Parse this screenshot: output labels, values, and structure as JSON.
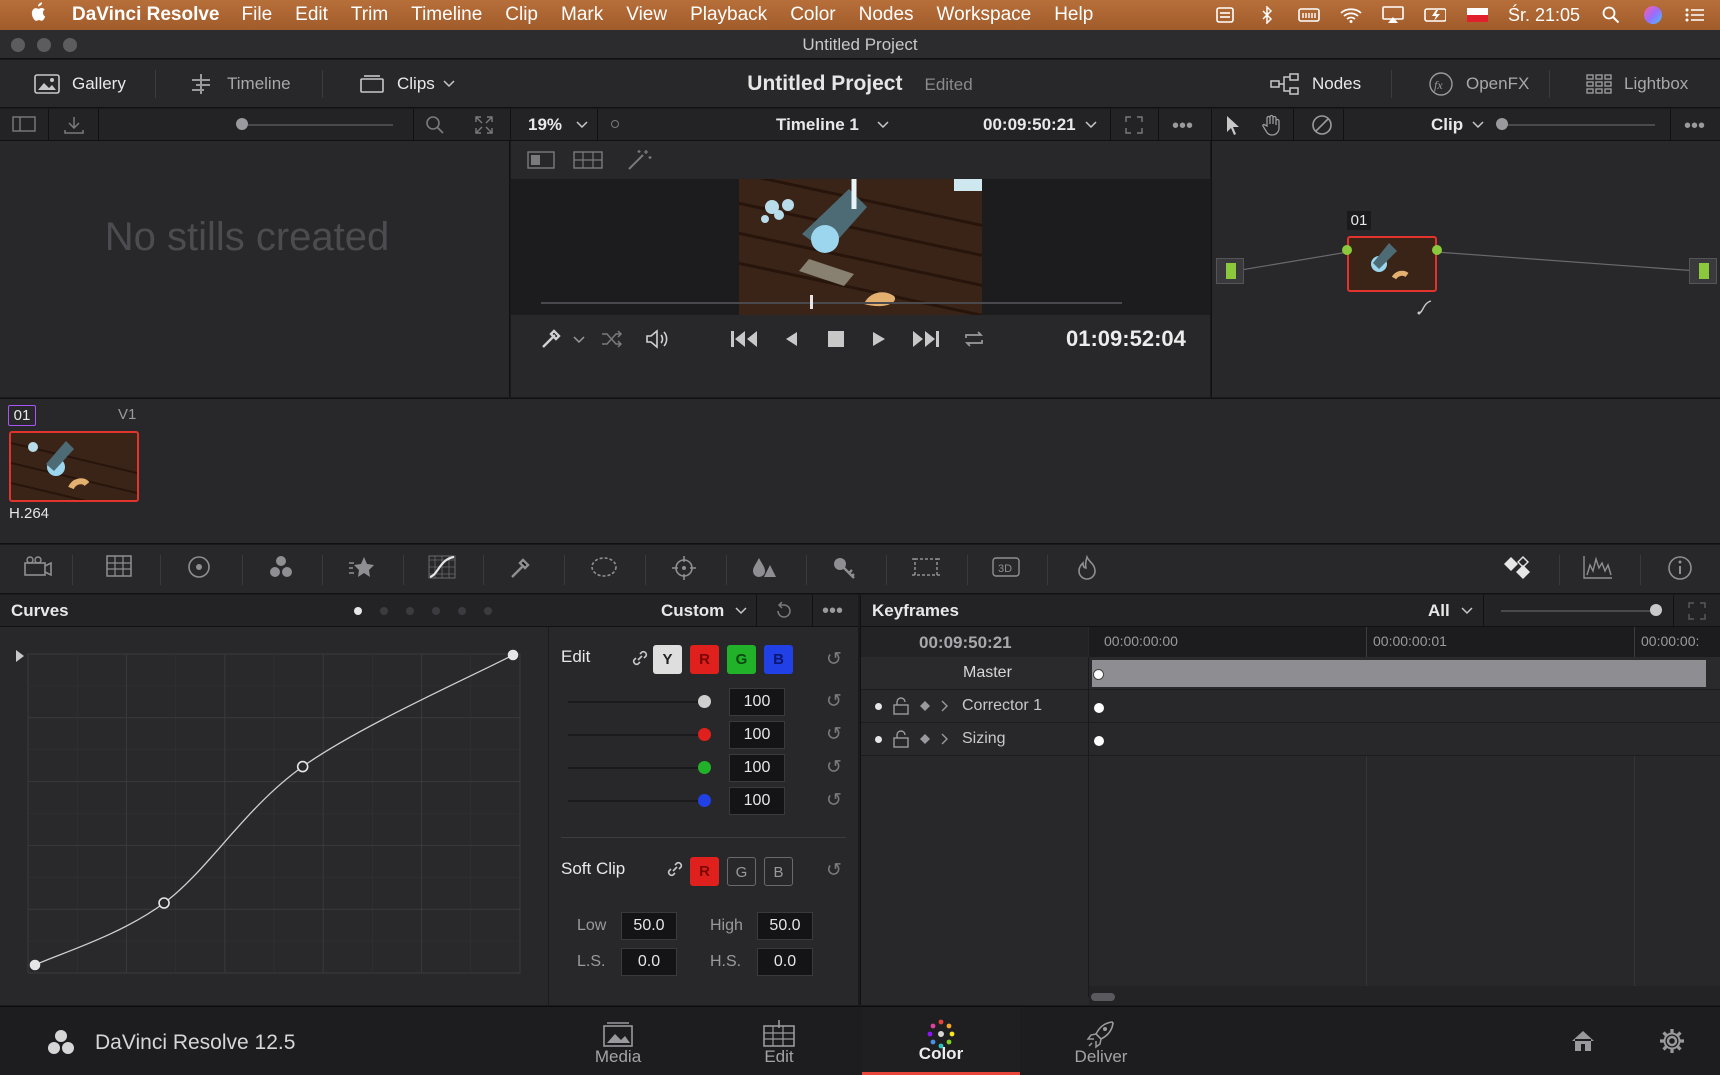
{
  "menubar": {
    "app": "DaVinci Resolve",
    "items": [
      "File",
      "Edit",
      "Trim",
      "Timeline",
      "Clip",
      "Mark",
      "View",
      "Playback",
      "Color",
      "Nodes",
      "Workspace",
      "Help"
    ],
    "clock": "Śr. 21:05"
  },
  "window": {
    "title": "Untitled Project"
  },
  "toolbar": {
    "gallery": "Gallery",
    "timeline": "Timeline",
    "clips": "Clips",
    "project_name": "Untitled Project",
    "project_status": "Edited",
    "nodes": "Nodes",
    "openfx": "OpenFX",
    "lightbox": "Lightbox"
  },
  "viewer_bar": {
    "zoom": "19%",
    "timeline_name": "Timeline 1",
    "timecode": "00:09:50:21",
    "clip_mode": "Clip"
  },
  "gallery": {
    "empty_text": "No stills created"
  },
  "viewer": {
    "playhead_timecode": "01:09:52:04",
    "scrub_position": 0.465
  },
  "nodes": {
    "node_label": "01"
  },
  "clips": {
    "items": [
      {
        "number": "01",
        "track": "V1",
        "codec": "H.264"
      }
    ]
  },
  "curves": {
    "title": "Curves",
    "preset": "Custom",
    "edit_label": "Edit",
    "channels": [
      "Y",
      "R",
      "G",
      "B"
    ],
    "intensity": [
      {
        "channel": "Y",
        "value": "100",
        "color": "#cfcfcf",
        "level": 1.0
      },
      {
        "channel": "R",
        "value": "100",
        "color": "#e0201c",
        "level": 1.0
      },
      {
        "channel": "G",
        "value": "100",
        "color": "#22b22a",
        "level": 1.0
      },
      {
        "channel": "B",
        "value": "100",
        "color": "#2140e6",
        "level": 1.0
      }
    ],
    "soft_clip_label": "Soft Clip",
    "soft_channels": [
      "R",
      "G",
      "B"
    ],
    "low_label": "Low",
    "low_value": "50.0",
    "high_label": "High",
    "high_value": "50.0",
    "ls_label": "L.S.",
    "ls_value": "0.0",
    "hs_label": "H.S.",
    "hs_value": "0.0",
    "control_points": [
      [
        0.0,
        0.0
      ],
      [
        0.27,
        0.2
      ],
      [
        0.56,
        0.64
      ],
      [
        1.0,
        1.0
      ]
    ]
  },
  "keyframes": {
    "title": "Keyframes",
    "filter": "All",
    "timecode": "00:09:50:21",
    "ruler": [
      "00:00:00:00",
      "00:00:00:01",
      "00:00:00:"
    ],
    "rows": [
      "Master",
      "Corrector 1",
      "Sizing"
    ]
  },
  "footer": {
    "app_version": "DaVinci Resolve 12.5",
    "tabs": [
      "Media",
      "Edit",
      "Color",
      "Deliver"
    ],
    "active_tab": "Color"
  },
  "colors": {
    "accent_red": "#e0342c",
    "node_green": "#8cc83c",
    "active_tab_underline": "#e8463a"
  }
}
